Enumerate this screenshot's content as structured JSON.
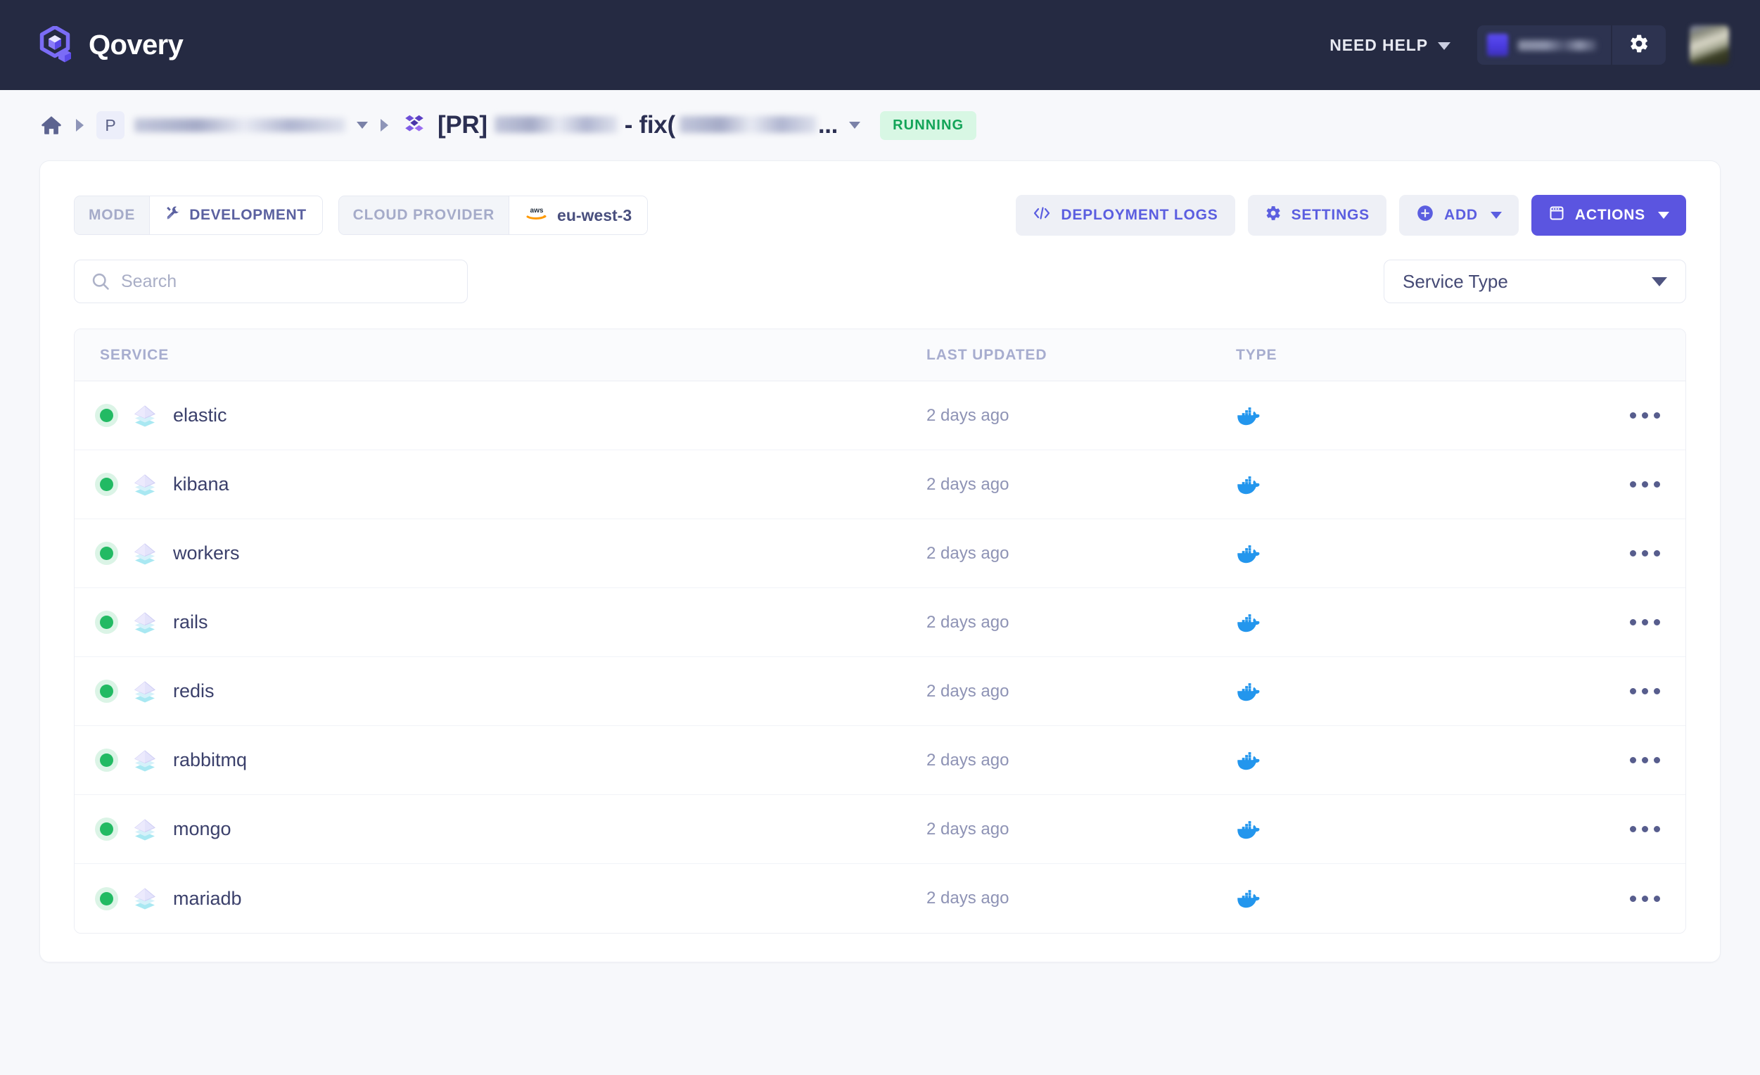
{
  "navbar": {
    "brand_name": "Qovery",
    "brand_logo_icon": "qovery-logo-icon",
    "need_help_label": "NEED HELP",
    "need_help_chevron_icon": "chevron-down-icon",
    "org_logo_icon": "organization-logo-icon",
    "org_name": "",
    "org_settings_icon": "gear-icon",
    "user_avatar": "user-avatar",
    "bg_color": "#252a42",
    "accent_color": "#5b55e0"
  },
  "breadcrumb": {
    "home_icon": "home-icon",
    "separator_icon": "caret-right-icon",
    "project_badge": "P",
    "project_name": "",
    "project_chevron_icon": "chevron-down-icon",
    "environment_icon": "preview-environment-icon",
    "environment_prefix": "[PR]",
    "environment_name_blur_1": "",
    "environment_separator": "- fix(",
    "environment_name_blur_2": "",
    "environment_ellipsis": "...",
    "environment_chevron_icon": "chevron-down-icon",
    "status_label": "RUNNING",
    "status_bg": "#d8f7e4",
    "status_color": "#12a458"
  },
  "toolbar": {
    "mode_label": "MODE",
    "mode_value": "DEVELOPMENT",
    "mode_icon": "tools-icon",
    "cloud_provider_label": "CLOUD PROVIDER",
    "cloud_provider_value": "eu-west-3",
    "cloud_provider_icon": "aws-icon",
    "deployment_logs_label": "DEPLOYMENT LOGS",
    "deployment_logs_icon": "code-icon",
    "settings_label": "SETTINGS",
    "settings_icon": "gear-icon",
    "add_label": "ADD",
    "add_icon": "plus-circle-icon",
    "add_caret_icon": "caret-down-icon",
    "actions_label": "ACTIONS",
    "actions_icon": "terminal-icon",
    "actions_caret_icon": "caret-down-icon"
  },
  "filters": {
    "search_placeholder": "Search",
    "search_value": "",
    "search_icon": "search-icon",
    "service_type_label": "Service Type",
    "service_type_caret_icon": "caret-down-icon"
  },
  "table": {
    "columns": [
      "SERVICE",
      "LAST UPDATED",
      "TYPE"
    ],
    "rows": [
      {
        "status": "running",
        "icon": "service-layers-icon",
        "name": "elastic",
        "last_updated": "2 days ago",
        "type_icon": "docker-icon",
        "menu_icon": "kebab-menu-icon"
      },
      {
        "status": "running",
        "icon": "service-layers-icon",
        "name": "kibana",
        "last_updated": "2 days ago",
        "type_icon": "docker-icon",
        "menu_icon": "kebab-menu-icon"
      },
      {
        "status": "running",
        "icon": "service-layers-icon",
        "name": "workers",
        "last_updated": "2 days ago",
        "type_icon": "docker-icon",
        "menu_icon": "kebab-menu-icon"
      },
      {
        "status": "running",
        "icon": "service-layers-icon",
        "name": "rails",
        "last_updated": "2 days ago",
        "type_icon": "docker-icon",
        "menu_icon": "kebab-menu-icon"
      },
      {
        "status": "running",
        "icon": "service-layers-icon",
        "name": "redis",
        "last_updated": "2 days ago",
        "type_icon": "docker-icon",
        "menu_icon": "kebab-menu-icon"
      },
      {
        "status": "running",
        "icon": "service-layers-icon",
        "name": "rabbitmq",
        "last_updated": "2 days ago",
        "type_icon": "docker-icon",
        "menu_icon": "kebab-menu-icon"
      },
      {
        "status": "running",
        "icon": "service-layers-icon",
        "name": "mongo",
        "last_updated": "2 days ago",
        "type_icon": "docker-icon",
        "menu_icon": "kebab-menu-icon"
      },
      {
        "status": "running",
        "icon": "service-layers-icon",
        "name": "mariadb",
        "last_updated": "2 days ago",
        "type_icon": "docker-icon",
        "menu_icon": "kebab-menu-icon"
      }
    ]
  }
}
